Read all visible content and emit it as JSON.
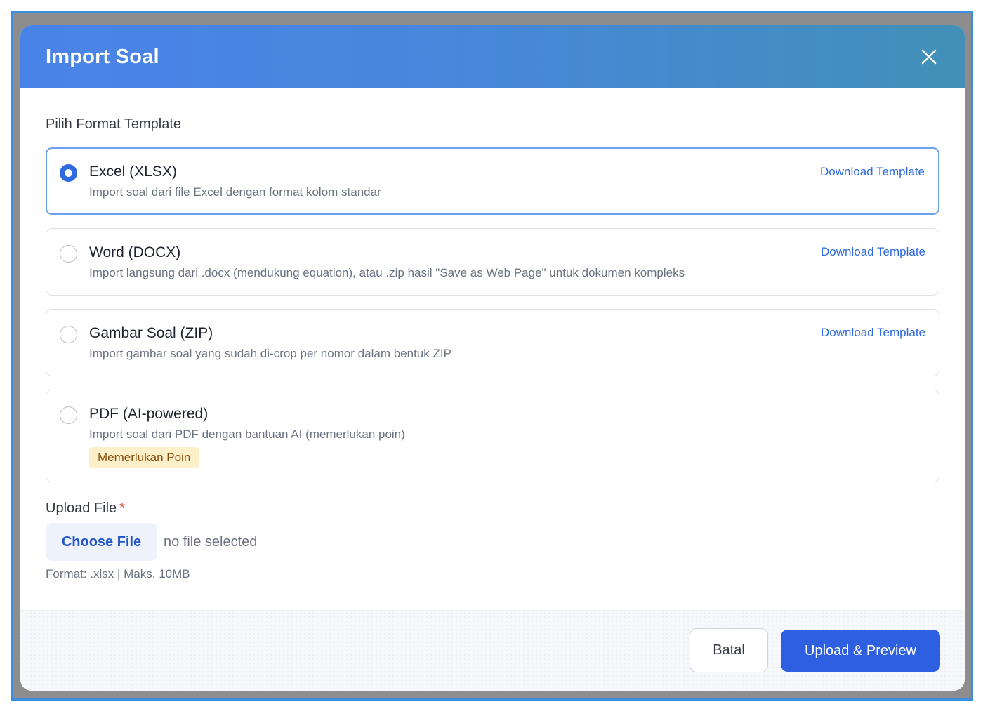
{
  "modal": {
    "title": "Import Soal",
    "close_icon": "close-icon"
  },
  "template_section": {
    "label": "Pilih Format Template",
    "options": [
      {
        "title": "Excel (XLSX)",
        "description": "Import soal dari file Excel dengan format kolom standar",
        "link": "Download Template",
        "selected": true
      },
      {
        "title": "Word (DOCX)",
        "description": "Import langsung dari .docx (mendukung equation), atau .zip hasil \"Save as Web Page\" untuk dokumen kompleks",
        "link": "Download Template",
        "selected": false
      },
      {
        "title": "Gambar Soal (ZIP)",
        "description": "Import gambar soal yang sudah di-crop per nomor dalam bentuk ZIP",
        "link": "Download Template",
        "selected": false
      },
      {
        "title": "PDF (AI-powered)",
        "description": "Import soal dari PDF dengan bantuan AI (memerlukan poin)",
        "badge": "Memerlukan Poin",
        "selected": false
      }
    ]
  },
  "upload": {
    "label": "Upload File",
    "required_mark": "*",
    "choose_button": "Choose File",
    "file_status": "no file selected",
    "hint": "Format: .xlsx | Maks. 10MB"
  },
  "footer": {
    "cancel_label": "Batal",
    "primary_label": "Upload & Preview"
  },
  "colors": {
    "accent": "#2d5fe0",
    "header_gradient_start": "#4a83e8",
    "header_gradient_end": "#4290b8",
    "badge_bg": "#fdf0c9",
    "badge_text": "#8a4b0b",
    "required": "#e0453a"
  }
}
